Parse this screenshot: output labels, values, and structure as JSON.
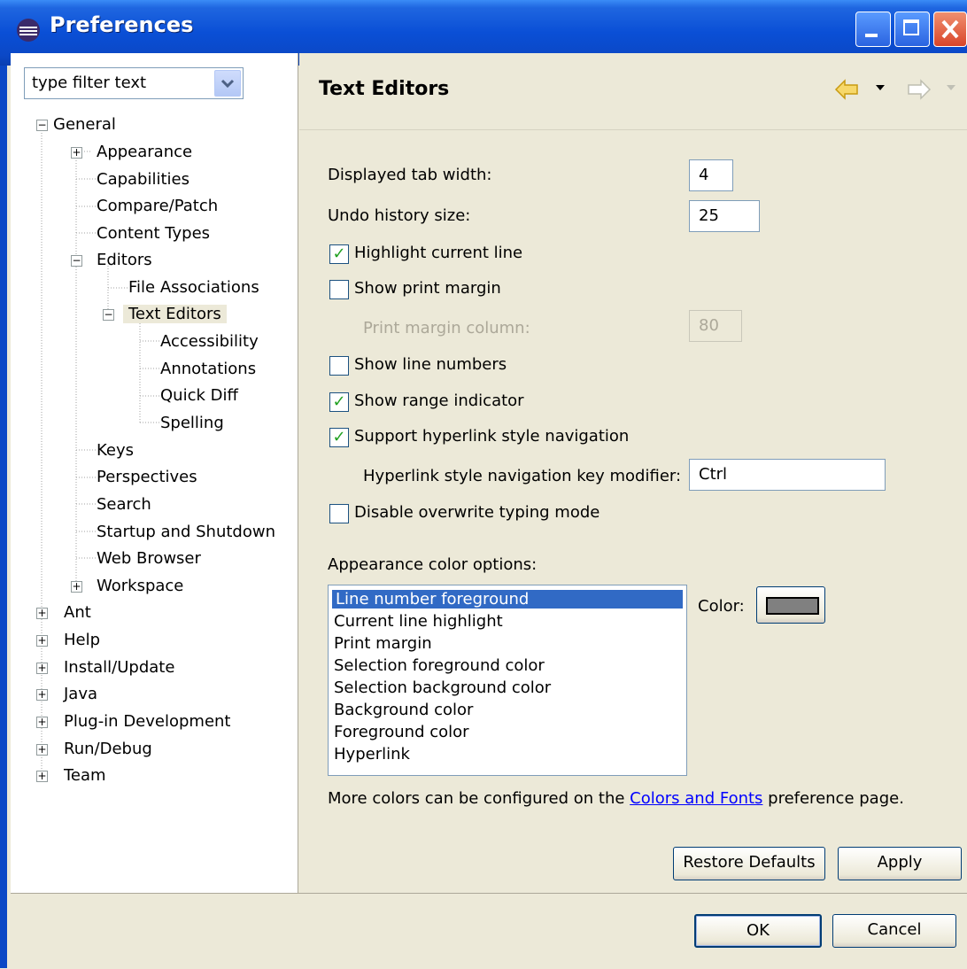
{
  "window": {
    "title": "Preferences"
  },
  "filter": {
    "placeholder": "type filter text"
  },
  "tree": [
    {
      "label": "General",
      "toggle": "-"
    },
    {
      "label": "Appearance",
      "toggle": "+"
    },
    {
      "label": "Capabilities"
    },
    {
      "label": "Compare/Patch"
    },
    {
      "label": "Content Types"
    },
    {
      "label": "Editors",
      "toggle": "-"
    },
    {
      "label": "File Associations"
    },
    {
      "label": "Text Editors",
      "toggle": "-",
      "selected": true
    },
    {
      "label": "Accessibility"
    },
    {
      "label": "Annotations"
    },
    {
      "label": "Quick Diff"
    },
    {
      "label": "Spelling"
    },
    {
      "label": "Keys"
    },
    {
      "label": "Perspectives"
    },
    {
      "label": "Search"
    },
    {
      "label": "Startup and Shutdown"
    },
    {
      "label": "Web Browser"
    },
    {
      "label": "Workspace",
      "toggle": "+"
    },
    {
      "label": "Ant",
      "toggle": "+"
    },
    {
      "label": "Help",
      "toggle": "+"
    },
    {
      "label": "Install/Update",
      "toggle": "+"
    },
    {
      "label": "Java",
      "toggle": "+"
    },
    {
      "label": "Plug-in Development",
      "toggle": "+"
    },
    {
      "label": "Run/Debug",
      "toggle": "+"
    },
    {
      "label": "Team",
      "toggle": "+"
    }
  ],
  "page": {
    "title": "Text Editors"
  },
  "settings": {
    "tab_width_label": "Displayed tab width:",
    "tab_width_value": "4",
    "undo_label": "Undo history size:",
    "undo_value": "25",
    "highlight_label": "Highlight current line",
    "print_margin_label": "Show print margin",
    "print_margin_col_label": "Print margin column:",
    "print_margin_col_value": "80",
    "line_numbers_label": "Show line numbers",
    "range_indicator_label": "Show range indicator",
    "hyperlink_label": "Support hyperlink style navigation",
    "hyperlink_modifier_label": "Hyperlink style navigation key modifier:",
    "hyperlink_modifier_value": "Ctrl",
    "overwrite_label": "Disable overwrite typing mode",
    "checked": {
      "highlight": true,
      "print_margin": false,
      "line_numbers": false,
      "range_indicator": true,
      "hyperlink": true,
      "overwrite": false
    }
  },
  "appearance": {
    "label": "Appearance color options:",
    "items": [
      "Line number foreground",
      "Current line highlight",
      "Print margin",
      "Selection foreground color",
      "Selection background color",
      "Background color",
      "Foreground color",
      "Hyperlink"
    ],
    "color_label": "Color:",
    "color_swatch": "#808080"
  },
  "more_colors": {
    "prefix": "More colors can be configured on the ",
    "link": "Colors and Fonts",
    "suffix": " preference page."
  },
  "buttons": {
    "restore": "Restore Defaults",
    "apply": "Apply",
    "ok": "OK",
    "cancel": "Cancel"
  },
  "colors": {
    "titlebar": "#0a4fd6",
    "selection": "#316ac5",
    "check": "#21a121"
  }
}
